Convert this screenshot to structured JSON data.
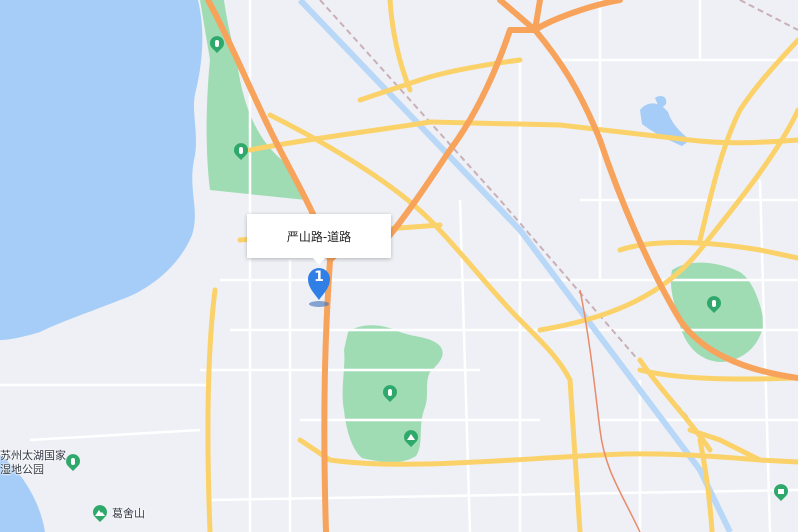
{
  "map": {
    "colors": {
      "background": "#eef0f5",
      "water": "#a5cdf7",
      "park": "#9fdcb4",
      "expressway": "#f7a35c",
      "arterial": "#fbd26a",
      "minor_road": "#ffffff",
      "railway": "#c9b0b6",
      "metro": "#e98a6a"
    },
    "callout": {
      "text": "严山路-道路"
    },
    "marker": {
      "label": "1",
      "color": "#2f7fe6"
    },
    "pois": [
      {
        "name": "苏州太湖国家\n湿地公园",
        "icon": "park-pin-icon"
      },
      {
        "name": "葛舍山",
        "icon": "mountain-pin-icon"
      }
    ],
    "icons": [
      "park-pin-icon",
      "park-pin-icon",
      "park-pin-icon",
      "park-pin-icon",
      "amusement-pin-icon",
      "mountain-pin-icon",
      "park-pin-icon"
    ]
  }
}
